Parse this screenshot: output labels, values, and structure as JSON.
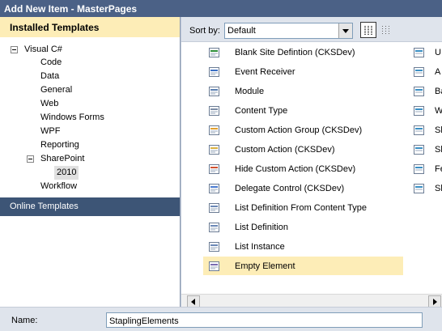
{
  "window": {
    "title": "Add New Item - MasterPages"
  },
  "left_pane": {
    "header": "Installed Templates",
    "tree": {
      "visual_csharp": "Visual C#",
      "code": "Code",
      "data": "Data",
      "general": "General",
      "web": "Web",
      "windows_forms": "Windows Forms",
      "wpf": "WPF",
      "reporting": "Reporting",
      "sharepoint": "SharePoint",
      "v2010": "2010",
      "workflow": "Workflow"
    },
    "online_templates": "Online Templates"
  },
  "toolbar": {
    "sort_by_label": "Sort by:",
    "sort_value": "Default"
  },
  "templates": [
    {
      "label": "Blank Site Defintion (CKSDev)",
      "icon": "site-definition-icon"
    },
    {
      "label": "Event Receiver",
      "icon": "event-receiver-icon"
    },
    {
      "label": "Module",
      "icon": "module-icon"
    },
    {
      "label": "Content Type",
      "icon": "content-type-icon"
    },
    {
      "label": "Custom Action Group (CKSDev)",
      "icon": "custom-action-group-icon"
    },
    {
      "label": "Custom Action (CKSDev)",
      "icon": "custom-action-icon"
    },
    {
      "label": "Hide Custom Action (CKSDev)",
      "icon": "hide-custom-action-icon"
    },
    {
      "label": "Delegate Control (CKSDev)",
      "icon": "delegate-control-icon"
    },
    {
      "label": "List Definition From Content Type",
      "icon": "list-definition-icon"
    },
    {
      "label": "List Definition",
      "icon": "list-definition-icon"
    },
    {
      "label": "List Instance",
      "icon": "list-instance-icon"
    },
    {
      "label": "Empty Element",
      "icon": "empty-element-icon",
      "selected": true
    }
  ],
  "templates_col2": [
    {
      "label": "U",
      "icon": "user-control-icon"
    },
    {
      "label": "A",
      "icon": "application-page-icon"
    },
    {
      "label": "Ba",
      "icon": "business-data-icon"
    },
    {
      "label": "W",
      "icon": "web-part-icon"
    },
    {
      "label": "Sl",
      "icon": "silverlight-icon"
    },
    {
      "label": "Sl",
      "icon": "silverlight-icon"
    },
    {
      "label": "Fe",
      "icon": "feature-icon"
    },
    {
      "label": "Sl",
      "icon": "site-icon"
    }
  ],
  "bottom": {
    "name_label": "Name:",
    "name_value": "StaplingElements"
  },
  "colors": {
    "title_bar": "#4b6186",
    "highlight": "#fdedb7",
    "online_templates_bg": "#3d5576"
  }
}
